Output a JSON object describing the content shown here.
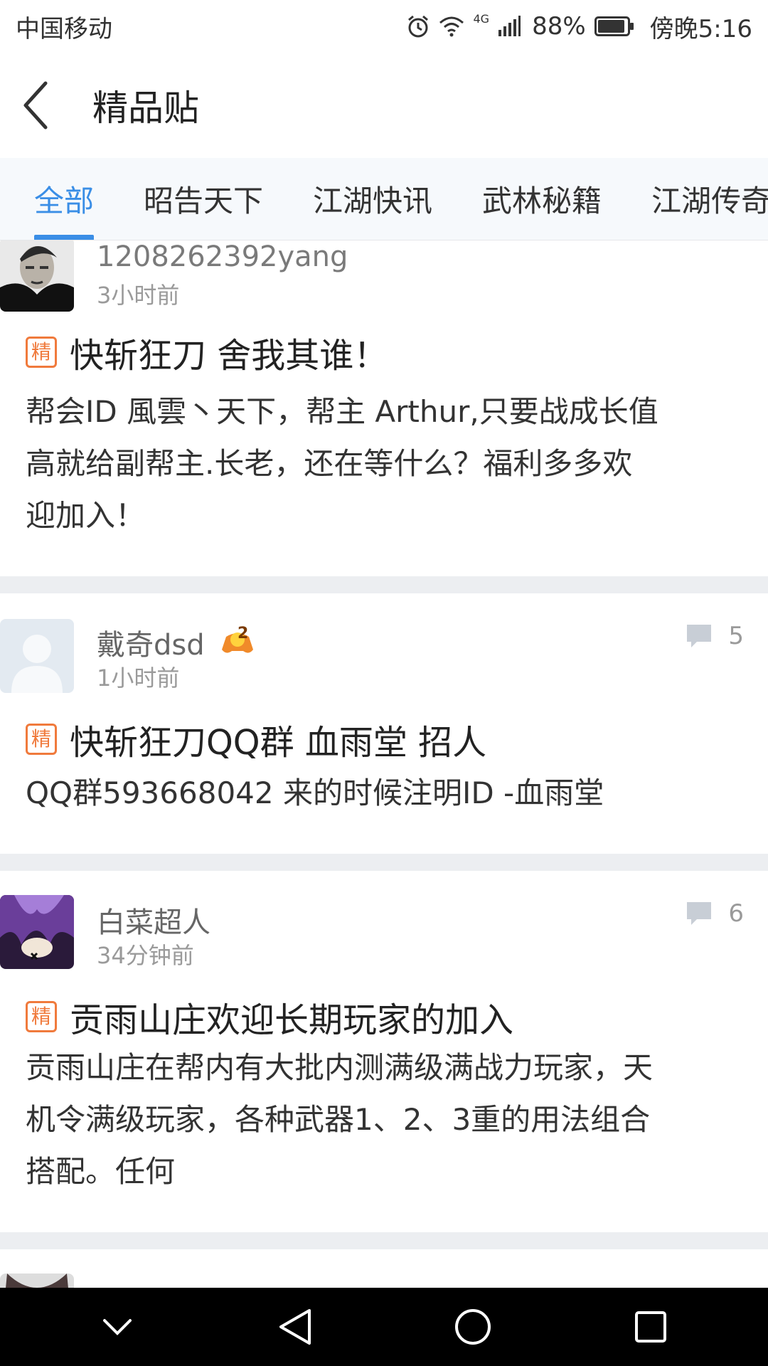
{
  "status_bar": {
    "carrier": "中国移动",
    "network": "4G",
    "battery": "88%",
    "time": "傍晚5:16"
  },
  "nav": {
    "title": "精品贴"
  },
  "tabs": [
    {
      "label": "全部",
      "active": true
    },
    {
      "label": "昭告天下"
    },
    {
      "label": "江湖快讯"
    },
    {
      "label": "武林秘籍"
    },
    {
      "label": "江湖传奇"
    }
  ],
  "badge_label": "精",
  "posts": [
    {
      "author": "1208262392yang",
      "time": "3小时前",
      "title": "快斩狂刀 舍我其谁！",
      "body_lines": [
        "帮会ID 風雲丶天下，帮主 Arthur,只要战成长值",
        "高就给副帮主.长老，还在等什么？福利多多欢",
        "迎加入！"
      ]
    },
    {
      "author": "戴奇dsd",
      "level": "2",
      "time": "1小时前",
      "comments": "5",
      "title": "快斩狂刀QQ群 血雨堂 招人",
      "body_lines": [
        "QQ群593668042 来的时候注明ID -血雨堂"
      ]
    },
    {
      "author": "白菜超人",
      "time": "34分钟前",
      "comments": "6",
      "title": "贡雨山庄欢迎长期玩家的加入",
      "body_lines": [
        "贡雨山庄在帮内有大批内测满级满战力玩家，天",
        "机令满级玩家，各种武器1、2、3重的用法组合",
        "搭配。任何"
      ]
    }
  ],
  "colors": {
    "accent": "#3a8ee6",
    "badge": "#f07a3c"
  }
}
